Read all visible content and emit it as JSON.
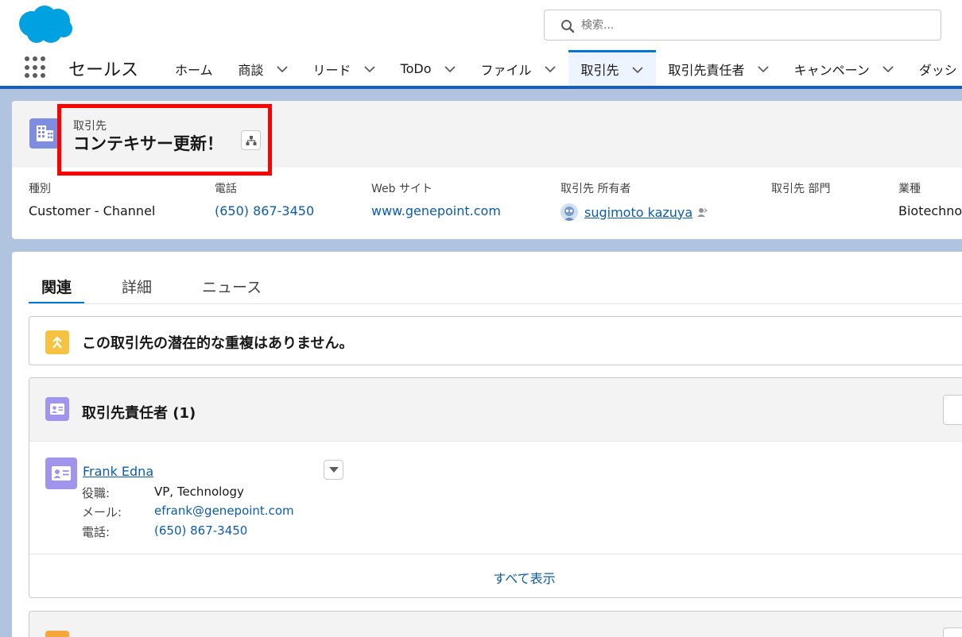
{
  "header": {
    "search_placeholder": "検索...",
    "app_name": "セールス",
    "nav_tabs": [
      {
        "label": "ホーム",
        "has_menu": false,
        "active": false
      },
      {
        "label": "商談",
        "has_menu": true,
        "active": false
      },
      {
        "label": "リード",
        "has_menu": true,
        "active": false
      },
      {
        "label": "ToDo",
        "has_menu": true,
        "active": false
      },
      {
        "label": "ファイル",
        "has_menu": true,
        "active": false
      },
      {
        "label": "取引先",
        "has_menu": true,
        "active": true
      },
      {
        "label": "取引先責任者",
        "has_menu": true,
        "active": false
      },
      {
        "label": "キャンペーン",
        "has_menu": true,
        "active": false
      },
      {
        "label": "ダッシ",
        "has_menu": false,
        "active": false
      }
    ]
  },
  "record": {
    "object_label": "取引先",
    "name": "コンテキサー更新！",
    "fields": [
      {
        "label": "種別",
        "value": "Customer - Channel",
        "link": false
      },
      {
        "label": "電話",
        "value": "(650) 867-3450",
        "link": true
      },
      {
        "label": "Web サイト",
        "value": "www.genepoint.com",
        "link": true
      },
      {
        "label": "取引先 所有者",
        "value": "sugimoto kazuya",
        "link": true,
        "owner": true
      },
      {
        "label": "取引先 部門",
        "value": "",
        "link": false
      },
      {
        "label": "業種",
        "value": "Biotechnol",
        "link": false
      }
    ]
  },
  "related": {
    "tabs": [
      {
        "label": "関連",
        "active": true
      },
      {
        "label": "詳細",
        "active": false
      },
      {
        "label": "ニュース",
        "active": false
      }
    ],
    "duplicates_message": "この取引先の潜在的な重複はありません。",
    "contacts": {
      "title": "取引先責任者 (1)",
      "items": [
        {
          "name": "Frank Edna",
          "rows": [
            {
              "label": "役職:",
              "value": "VP, Technology",
              "link": false
            },
            {
              "label": "メール:",
              "value": "efrank@genepoint.com",
              "link": true
            },
            {
              "label": "電話:",
              "value": "(650) 867-3450",
              "link": true
            }
          ]
        }
      ],
      "view_all": "すべて表示"
    }
  },
  "colors": {
    "brand_blue": "#0176d3",
    "link": "#0b5cab",
    "highlight_red": "#ff0000",
    "account_icon": "#7f8de1",
    "contact_icon": "#a094ed",
    "duplicate_icon": "#f5c242"
  }
}
